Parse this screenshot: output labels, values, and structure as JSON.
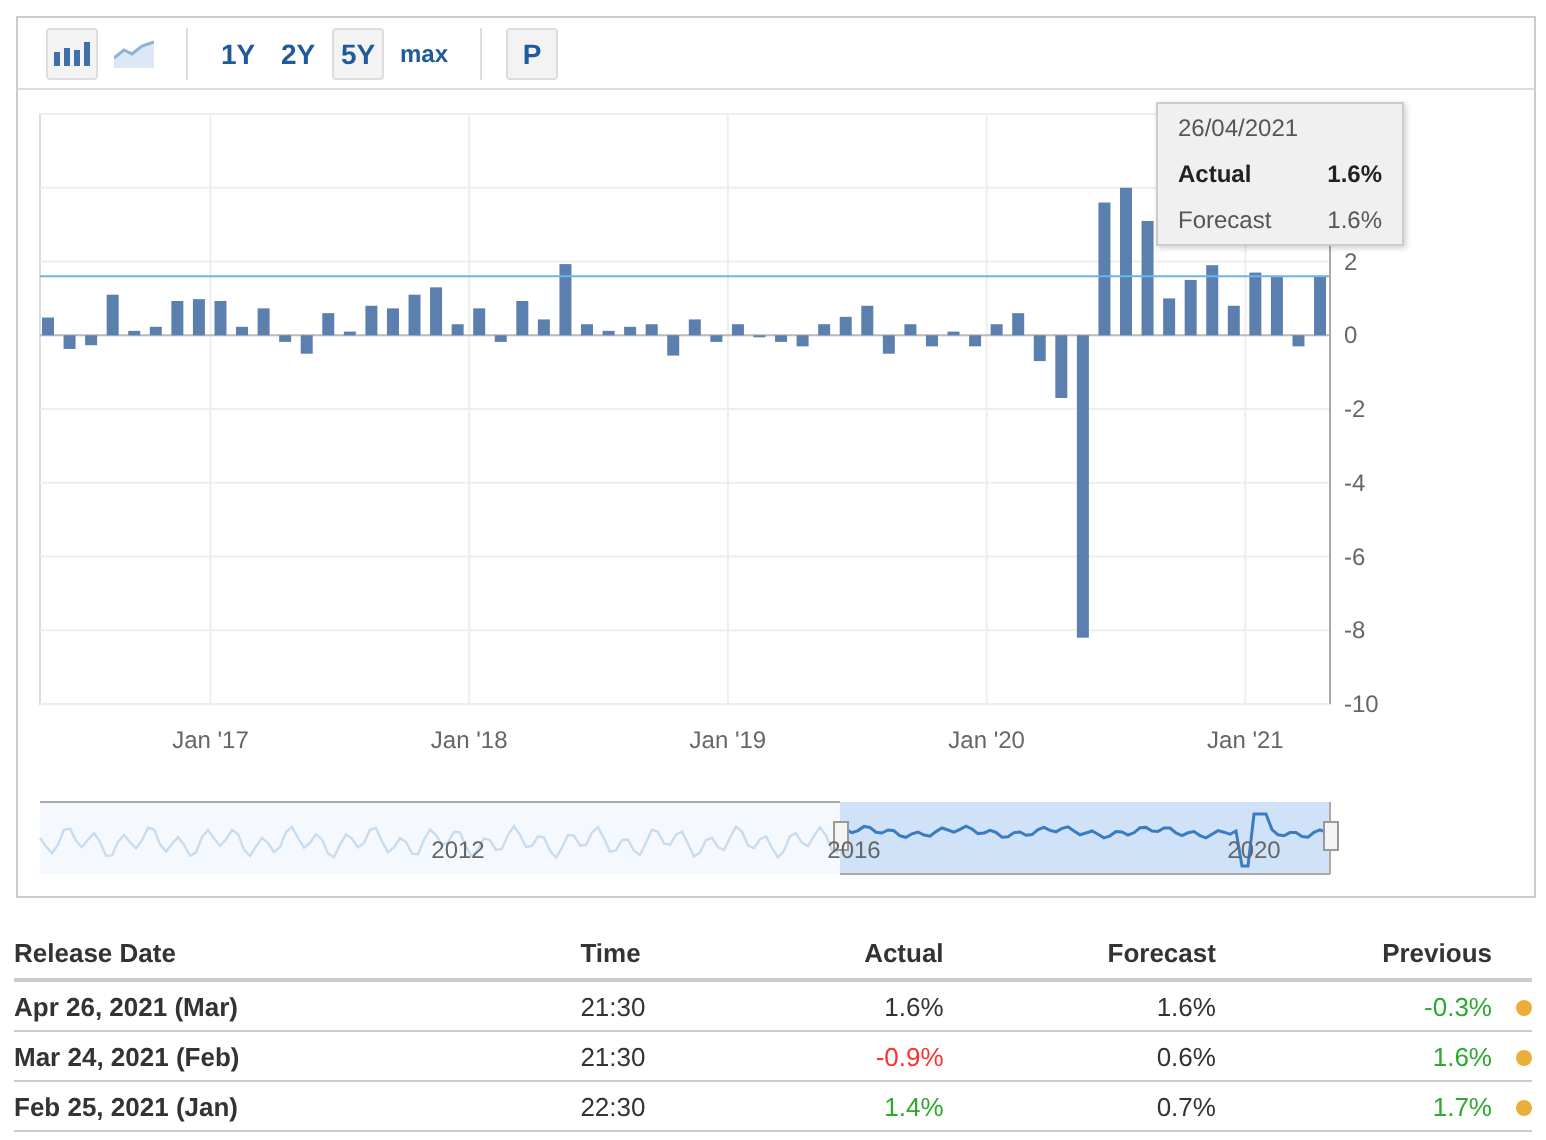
{
  "toolbar": {
    "chart_types": [
      {
        "kind": "bar",
        "selected": true
      },
      {
        "kind": "line",
        "selected": false
      }
    ],
    "ranges": [
      {
        "label": "1Y",
        "selected": false
      },
      {
        "label": "2Y",
        "selected": false
      },
      {
        "label": "5Y",
        "selected": true
      },
      {
        "label": "max",
        "selected": false
      }
    ],
    "extra_button": "P"
  },
  "chart": {
    "chart_data": {
      "type": "bar",
      "grid": true,
      "ylim": [
        -10,
        6
      ],
      "yticks": [
        -10,
        -8,
        -6,
        -4,
        -2,
        0,
        2
      ],
      "categories": [
        null,
        null,
        null,
        null,
        null,
        null,
        null,
        null,
        "Jan '17",
        null,
        null,
        null,
        null,
        null,
        null,
        null,
        null,
        null,
        null,
        null,
        "Jan '18",
        null,
        null,
        null,
        null,
        null,
        null,
        null,
        null,
        null,
        null,
        null,
        "Jan '19",
        null,
        null,
        null,
        null,
        null,
        null,
        null,
        null,
        null,
        null,
        null,
        "Jan '20",
        null,
        null,
        null,
        null,
        null,
        null,
        null,
        null,
        null,
        null,
        null,
        "Jan '21",
        null,
        null,
        null
      ],
      "series": [
        {
          "color": "#5b80b0",
          "values": [
            0.48,
            -0.37,
            -0.27,
            1.1,
            0.12,
            0.23,
            0.93,
            0.98,
            0.93,
            0.23,
            0.73,
            -0.18,
            -0.5,
            0.6,
            0.1,
            0.8,
            0.73,
            1.1,
            1.3,
            0.3,
            0.73,
            -0.18,
            0.93,
            0.43,
            1.93,
            0.3,
            0.12,
            0.23,
            0.3,
            -0.55,
            0.43,
            -0.18,
            0.3,
            -0.05,
            -0.18,
            -0.3,
            0.3,
            0.5,
            0.8,
            -0.5,
            0.3,
            -0.3,
            0.1,
            -0.3,
            0.3,
            0.6,
            -0.7,
            -1.7,
            -8.2,
            3.6,
            4.0,
            3.1,
            1.0,
            1.5,
            1.9,
            0.8,
            1.7,
            1.6,
            -0.3,
            1.6
          ]
        }
      ],
      "ref_lines": [
        {
          "axis": "y",
          "value": 1.6,
          "color": "#6ab4f0"
        }
      ]
    },
    "tooltip": {
      "date": "26/04/2021",
      "rows": [
        {
          "label": "Actual",
          "value": "1.6%",
          "kind": "bold"
        },
        {
          "label": "Forecast",
          "value": "1.6%",
          "kind": "plain"
        }
      ]
    },
    "navigator": {
      "labels": [
        "2012",
        "2016",
        "2020"
      ]
    }
  },
  "table": {
    "columns": [
      "Release Date",
      "Time",
      "Actual",
      "Forecast",
      "Previous"
    ],
    "rows": [
      {
        "release_date": "Apr 26, 2021 (Mar)",
        "time": "21:30",
        "actual": {
          "text": "1.6%",
          "color": "#333333"
        },
        "forecast": "1.6%",
        "previous": {
          "text": "-0.3%",
          "color": "#2ea82e"
        },
        "color": "#eaae3b"
      },
      {
        "release_date": "Mar 24, 2021 (Feb)",
        "time": "21:30",
        "actual": {
          "text": "-0.9%",
          "color": "#ff3030"
        },
        "forecast": "0.6%",
        "previous": {
          "text": "1.6%",
          "color": "#2ea82e"
        },
        "color": "#eaae3b"
      },
      {
        "release_date": "Feb 25, 2021 (Jan)",
        "time": "22:30",
        "actual": {
          "text": "1.4%",
          "color": "#2ea82e"
        },
        "forecast": "0.7%",
        "previous": {
          "text": "1.7%",
          "color": "#2ea82e"
        },
        "color": "#eaae3b"
      }
    ]
  }
}
